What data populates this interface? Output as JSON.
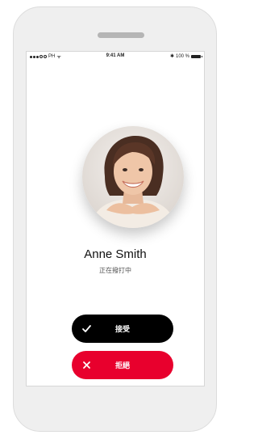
{
  "status_bar": {
    "carrier": "PH",
    "time": "9:41 AM",
    "battery": "100 %"
  },
  "caller": {
    "name": "Anne Smith",
    "status": "正在撥打中",
    "avatar_icon": "person-photo"
  },
  "actions": {
    "accept_label": "接受",
    "accept_icon": "check-icon",
    "accept_color": "#000000",
    "decline_label": "拒絕",
    "decline_icon": "close-icon",
    "decline_color": "#e8002d"
  }
}
